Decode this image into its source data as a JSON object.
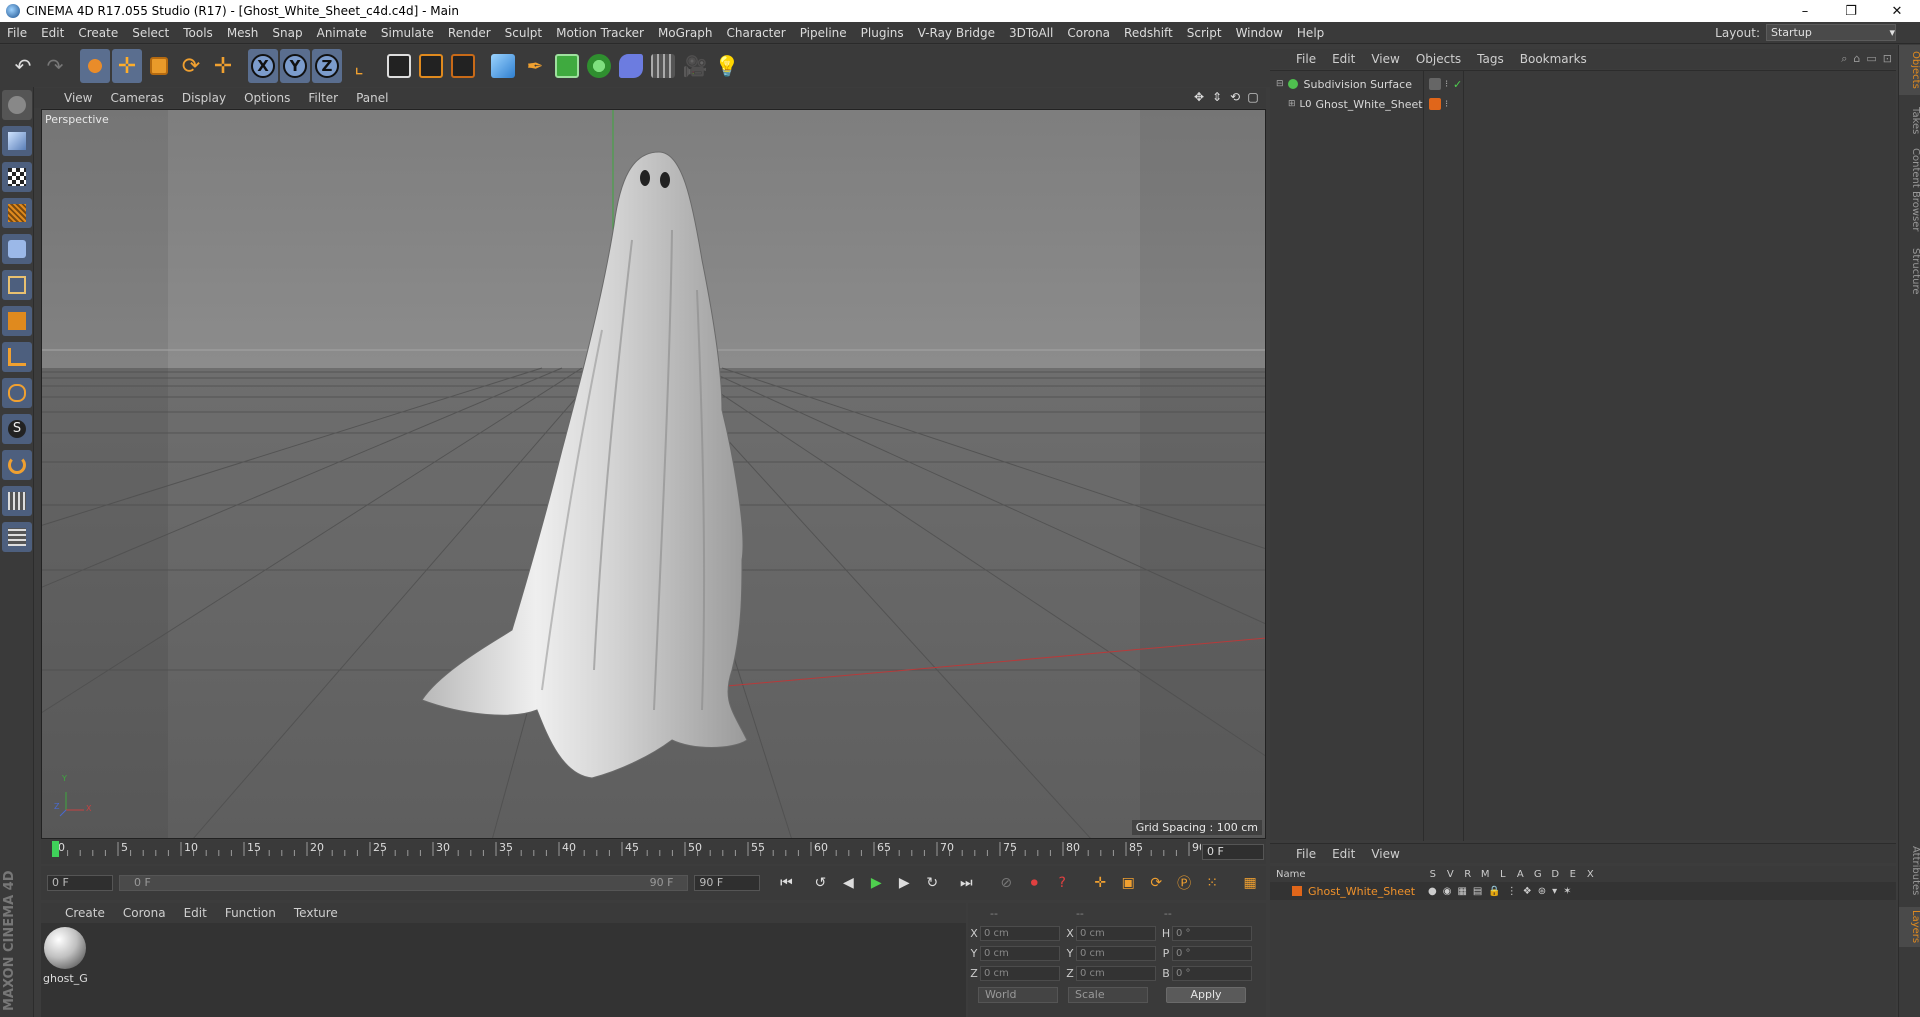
{
  "window": {
    "title": "CINEMA 4D R17.055 Studio (R17) - [Ghost_White_Sheet_c4d.c4d] - Main",
    "minimize": "–",
    "restore": "❐",
    "close": "✕"
  },
  "menubar": {
    "items": [
      "File",
      "Edit",
      "Create",
      "Select",
      "Tools",
      "Mesh",
      "Snap",
      "Animate",
      "Simulate",
      "Render",
      "Sculpt",
      "Motion Tracker",
      "MoGraph",
      "Character",
      "Pipeline",
      "Plugins",
      "V-Ray Bridge",
      "3DToAll",
      "Corona",
      "Redshift",
      "Script",
      "Window",
      "Help"
    ],
    "layout_label": "Layout:",
    "layout_value": "Startup"
  },
  "toolbar": {
    "axis_x": "X",
    "axis_y": "Y",
    "axis_z": "Z"
  },
  "viewport": {
    "menu": [
      "View",
      "Cameras",
      "Display",
      "Options",
      "Filter",
      "Panel"
    ],
    "label": "Perspective",
    "grid_spacing": "Grid Spacing : 100 cm",
    "axis_y": "Y",
    "axis_x": "X",
    "axis_z": "Z"
  },
  "timeline": {
    "ticks": [
      "0",
      "5",
      "10",
      "15",
      "20",
      "25",
      "30",
      "35",
      "40",
      "45",
      "50",
      "55",
      "60",
      "65",
      "70",
      "75",
      "80",
      "85",
      "90"
    ],
    "current_frame": "0 F"
  },
  "transport": {
    "start_field": "0 F",
    "range_start": "0 F",
    "range_end": "90 F",
    "end_field": "90 F"
  },
  "material_manager": {
    "menu": [
      "Create",
      "Corona",
      "Edit",
      "Function",
      "Texture"
    ],
    "material_name": "ghost_G"
  },
  "coordinates": {
    "header": [
      "--",
      "--",
      "--"
    ],
    "rows": [
      {
        "a": "X",
        "av": "0 cm",
        "b": "X",
        "bv": "0 cm",
        "c": "H",
        "cv": "0 °"
      },
      {
        "a": "Y",
        "av": "0 cm",
        "b": "Y",
        "bv": "0 cm",
        "c": "P",
        "cv": "0 °"
      },
      {
        "a": "Z",
        "av": "0 cm",
        "b": "Z",
        "bv": "0 cm",
        "c": "B",
        "cv": "0 °"
      }
    ],
    "world": "World",
    "scale": "Scale",
    "apply": "Apply"
  },
  "object_manager": {
    "menu": [
      "File",
      "Edit",
      "View",
      "Objects",
      "Tags",
      "Bookmarks"
    ],
    "objects": [
      {
        "name": "Subdivision Surface"
      },
      {
        "name": "Ghost_White_Sheet"
      }
    ]
  },
  "layers_manager": {
    "menu": [
      "File",
      "Edit",
      "View"
    ],
    "name_col": "Name",
    "cols": [
      "S",
      "V",
      "R",
      "M",
      "L",
      "A",
      "G",
      "D",
      "E",
      "X"
    ],
    "layer_name": "Ghost_White_Sheet"
  },
  "right_tabs": [
    "Objects",
    "Takes",
    "Content Browser",
    "Structure",
    "Attributes",
    "Layers"
  ],
  "colors": {
    "accent_orange": "#e08a1e",
    "layer_orange": "#f0922b",
    "tool_blue": "#4d5f7e"
  }
}
